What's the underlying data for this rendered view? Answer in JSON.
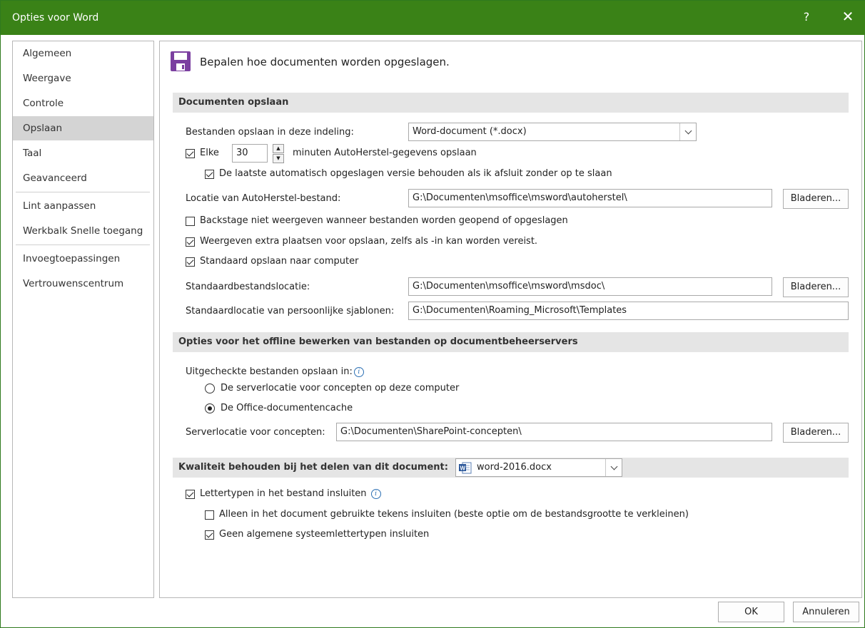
{
  "window": {
    "title": "Opties voor Word",
    "help": "?",
    "close": "✕"
  },
  "sidebar": {
    "items": [
      {
        "label": "Algemeen"
      },
      {
        "label": "Weergave"
      },
      {
        "label": "Controle"
      },
      {
        "label": "Opslaan",
        "active": true
      },
      {
        "label": "Taal"
      },
      {
        "label": "Geavanceerd"
      },
      {
        "label": "Lint aanpassen"
      },
      {
        "label": "Werkbalk Snelle toegang"
      },
      {
        "label": "Invoegtoepassingen"
      },
      {
        "label": "Vertrouwenscentrum"
      }
    ]
  },
  "header": {
    "icon": "floppy-disk-icon",
    "text": "Bepalen hoe documenten worden opgeslagen."
  },
  "save": {
    "section_title": "Documenten opslaan",
    "format_label": "Bestanden opslaan in deze indeling:",
    "format_value": "Word-document (*.docx)",
    "every_label": "Elke",
    "every_value": "30",
    "minutes_label": "minuten AutoHerstel-gegevens opslaan",
    "keep_last_label": "De laatste automatisch opgeslagen versie behouden als ik afsluit zonder op te slaan",
    "autorecover_label": "Locatie van AutoHerstel-bestand:",
    "autorecover_value": "G:\\Documenten\\msoffice\\msword\\autoherstel\\",
    "browse": "Bladeren...",
    "backstage_label": "Backstage niet weergeven wanneer bestanden worden geopend of opgeslagen",
    "extra_places_label": "Weergeven extra plaatsen voor opslaan, zelfs als  -in kan worden vereist.",
    "default_computer_label": "Standaard opslaan naar computer",
    "default_location_label": "Standaardbestandslocatie:",
    "default_location_value": "G:\\Documenten\\msoffice\\msword\\msdoc\\",
    "templates_label": "Standaardlocatie van persoonlijke sjablonen:",
    "templates_value": "G:\\Documenten\\Roaming_Microsoft\\Templates"
  },
  "offline": {
    "section_title": "Opties voor het offline bewerken van bestanden op documentbeheerservers",
    "checked_out_label": "Uitgecheckte bestanden opslaan in:",
    "radio_server": "De serverlocatie voor concepten op deze computer",
    "radio_cache": "De Office-documentencache",
    "server_drafts_label": "Serverlocatie voor concepten:",
    "server_drafts_value": "G:\\Documenten\\SharePoint-concepten\\",
    "browse": "Bladeren..."
  },
  "quality": {
    "section_title": "Kwaliteit behouden bij het delen van dit document:",
    "document_value": "word-2016.docx",
    "embed_fonts_label": "Lettertypen in het bestand insluiten",
    "only_used_label": "Alleen in het document gebruikte tekens insluiten (beste optie om de bestandsgrootte te verkleinen)",
    "no_system_label": "Geen algemene systeemlettertypen insluiten"
  },
  "footer": {
    "ok": "OK",
    "cancel": "Annuleren"
  },
  "colors": {
    "titlebar": "#3a8217",
    "accent_icon": "#7b3fa0"
  }
}
